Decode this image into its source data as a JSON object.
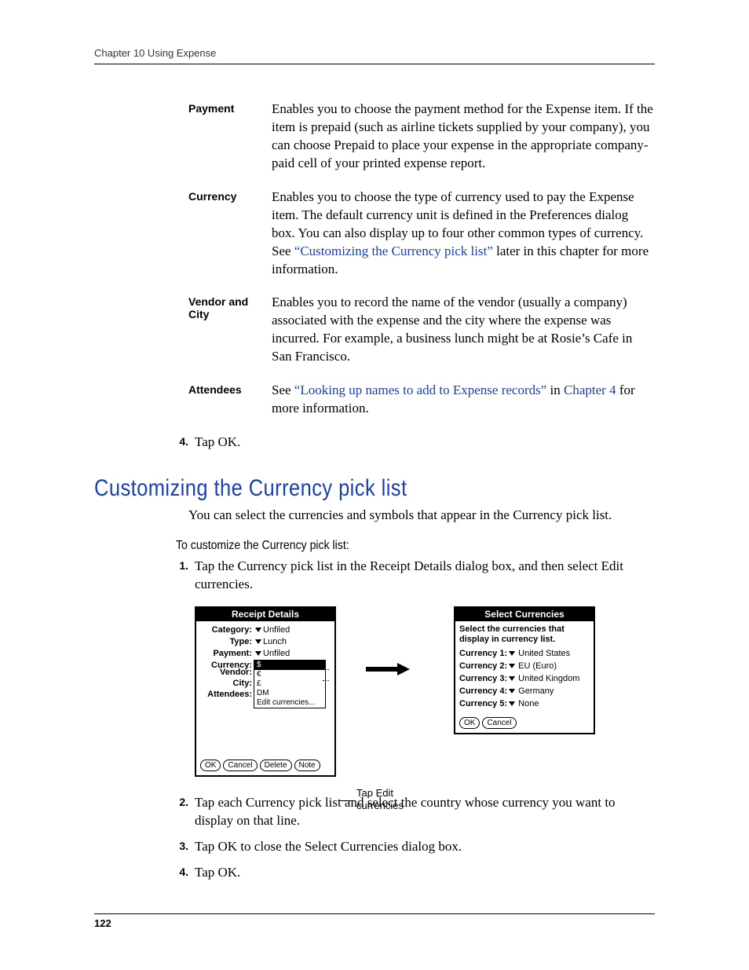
{
  "header": {
    "running": "Chapter 10    Using Expense"
  },
  "defs": [
    {
      "term": "Payment",
      "body": "Enables you to choose the payment method for the Expense item. If the item is prepaid (such as airline tickets supplied by your company), you can choose Prepaid to place your expense in the appropriate company-paid cell of your printed expense report."
    },
    {
      "term": "Currency",
      "body_pre": "Enables you to choose the type of currency used to pay the Expense item. The default currency unit is defined in the Preferences dialog box. You can also display up to four other common types of currency. See ",
      "link": "“Customizing the Currency pick list”",
      "body_post": " later in this chapter for more information."
    },
    {
      "term": "Vendor and City",
      "body": "Enables you to record the name of the vendor (usually a company) associated with the expense and the city where the expense was incurred. For example, a business lunch might be at Rosie’s Cafe in San Francisco."
    },
    {
      "term": "Attendees",
      "body_pre": "See ",
      "link1": "“Looking up names to add to Expense records”",
      "mid": " in ",
      "link2": "Chapter 4",
      "body_post": " for more information."
    }
  ],
  "step4a": {
    "num": "4.",
    "text": "Tap OK."
  },
  "section_title": "Customizing the Currency pick list",
  "intro": "You can select the currencies and symbols that appear in the Currency pick list.",
  "subhead": "To customize the Currency pick list:",
  "steps": [
    {
      "num": "1.",
      "text": "Tap the Currency pick list in the Receipt Details dialog box, and then select Edit currencies."
    }
  ],
  "figure": {
    "receipt": {
      "title": "Receipt Details",
      "rows": {
        "category_label": "Category:",
        "category_value": "Unfiled",
        "type_label": "Type:",
        "type_value": "Lunch",
        "payment_label": "Payment:",
        "payment_value": "Unfiled",
        "currency_label": "Currency:",
        "vendor_label": "Vendor:",
        "city_label": "City:",
        "attendees_label": "Attendees:"
      },
      "dropdown": [
        "$",
        "€",
        "£",
        "DM",
        "Edit currencies..."
      ],
      "buttons": [
        "OK",
        "Cancel",
        "Delete",
        "Note"
      ]
    },
    "callout": "Tap Edit currencies",
    "select": {
      "title": "Select Currencies",
      "instr": "Select the currencies that display in currency list.",
      "rows": [
        {
          "label": "Currency 1:",
          "value": "United States"
        },
        {
          "label": "Currency 2:",
          "value": "EU (Euro)"
        },
        {
          "label": "Currency 3:",
          "value": "United Kingdom"
        },
        {
          "label": "Currency 4:",
          "value": "Germany"
        },
        {
          "label": "Currency 5:",
          "value": "None"
        }
      ],
      "buttons": [
        "OK",
        "Cancel"
      ]
    }
  },
  "steps_after": [
    {
      "num": "2.",
      "text": "Tap each Currency pick list and select the country whose currency you want to display on that line."
    },
    {
      "num": "3.",
      "text": "Tap OK to close the Select Currencies dialog box."
    },
    {
      "num": "4.",
      "text": "Tap OK."
    }
  ],
  "page_number": "122"
}
